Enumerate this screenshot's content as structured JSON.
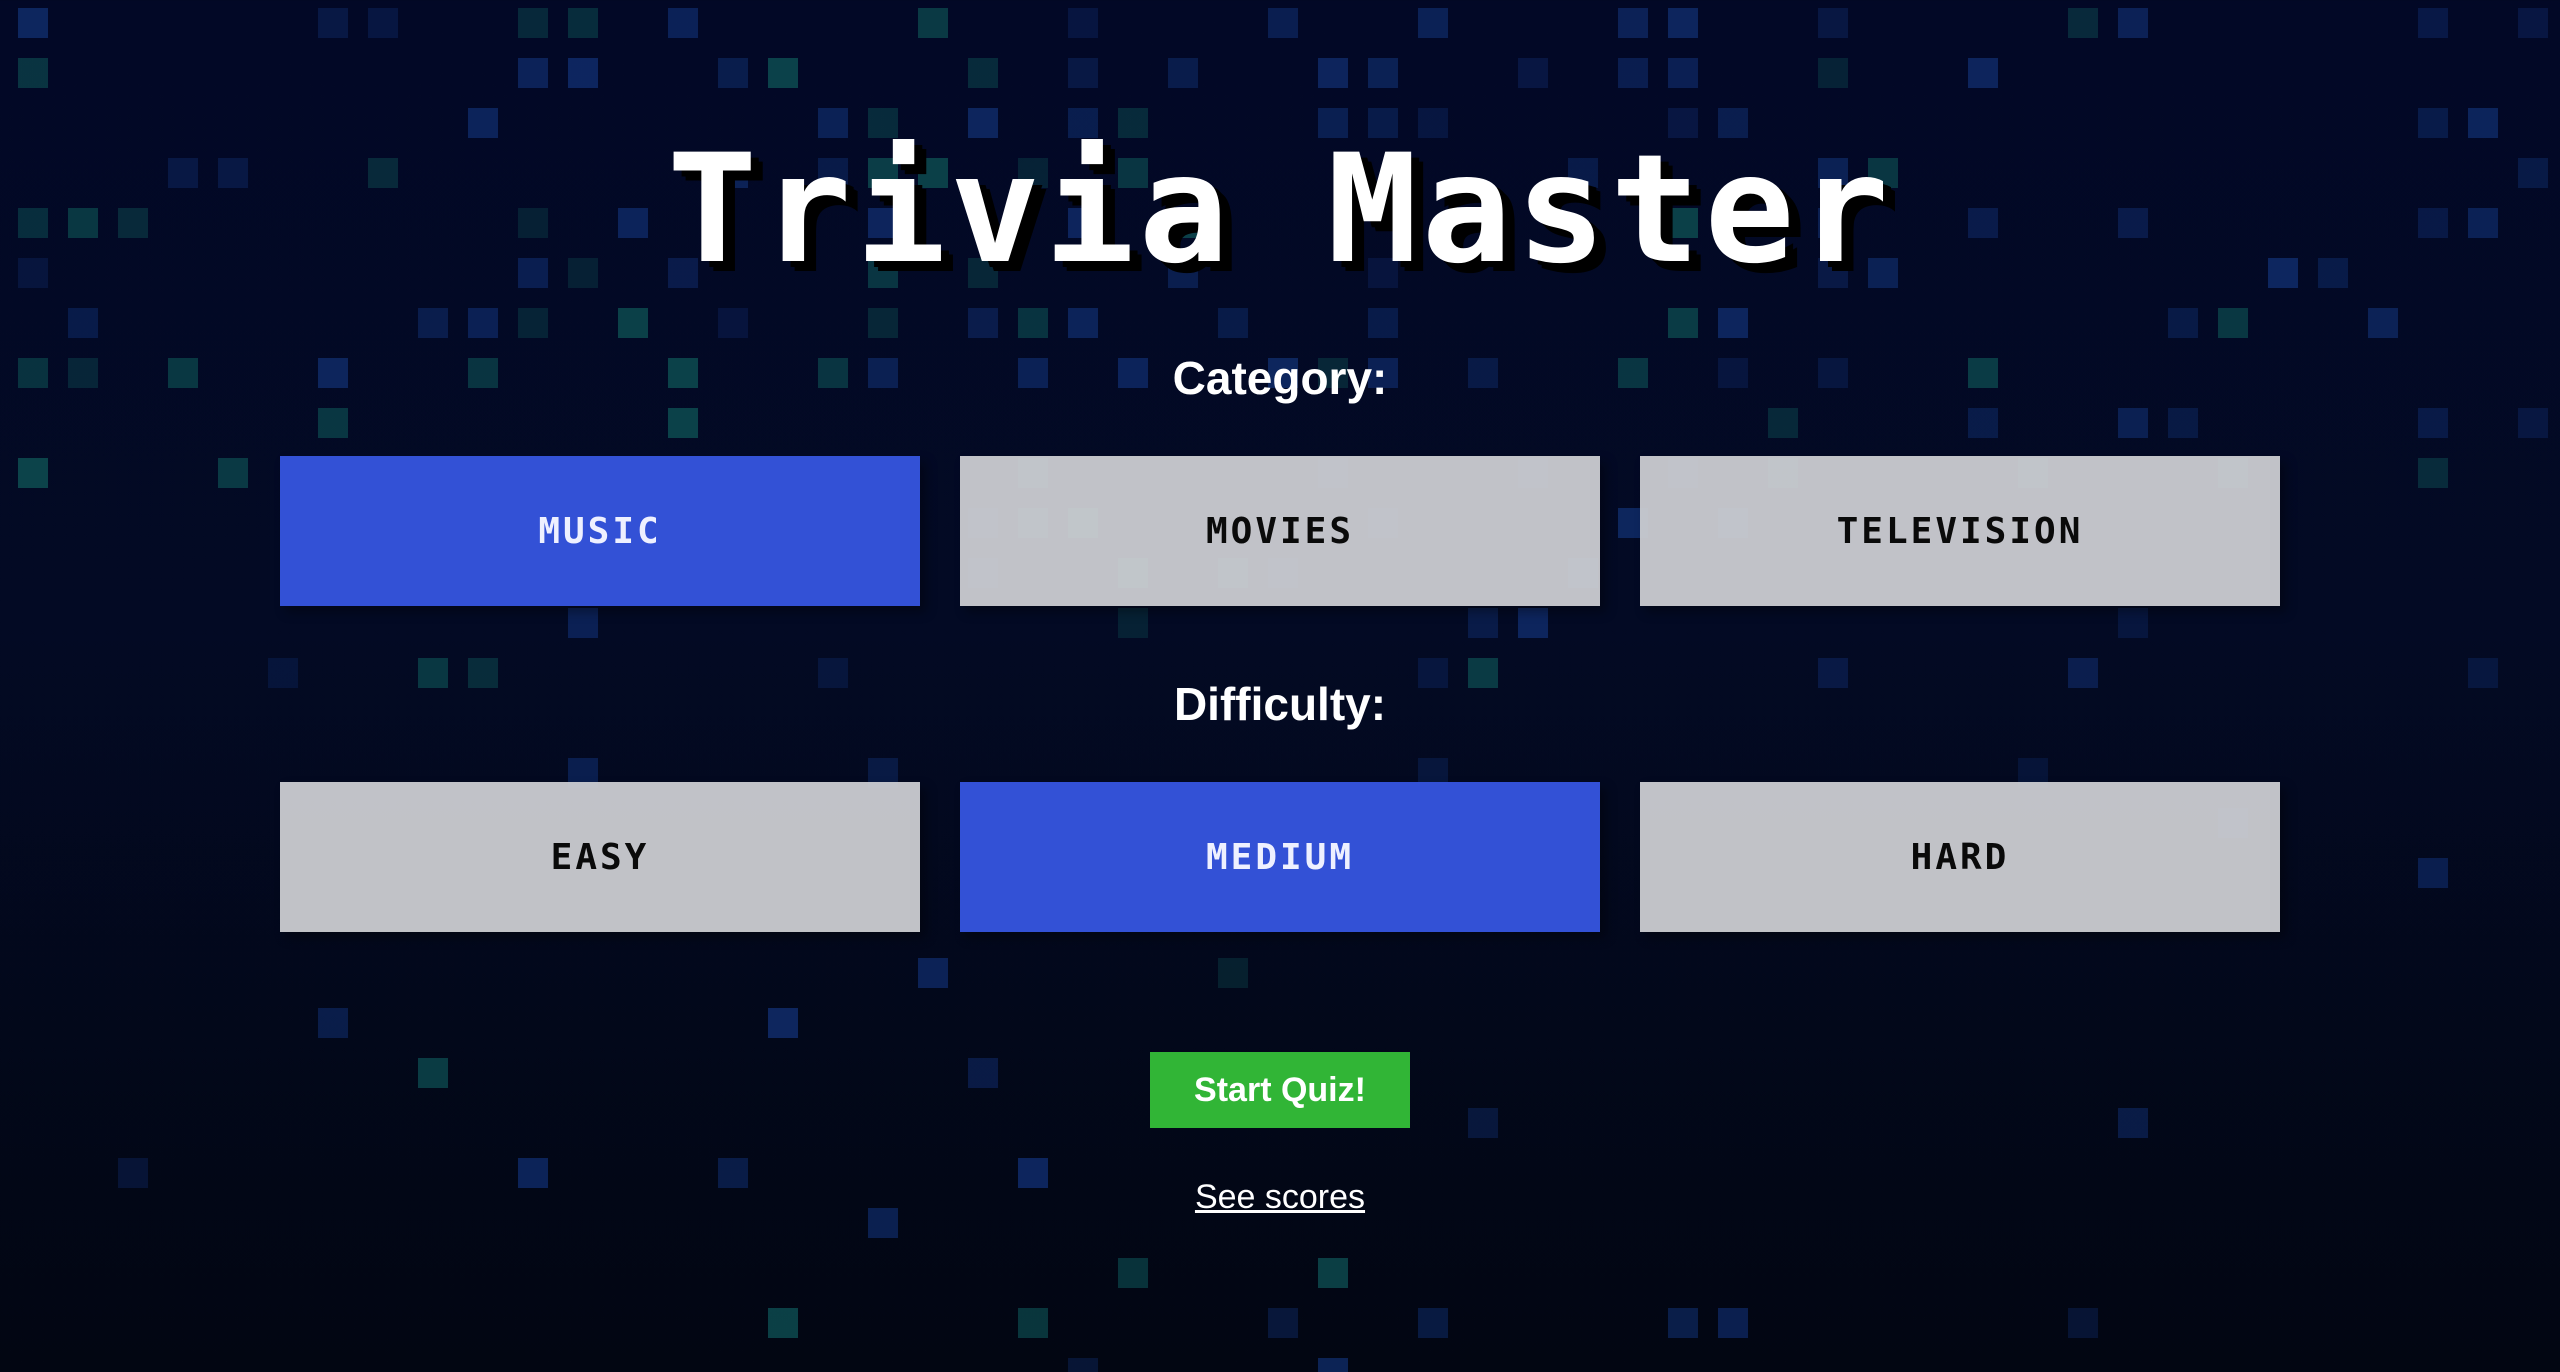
{
  "title": "Trivia Master",
  "category": {
    "label": "Category:",
    "options": [
      "MUSIC",
      "MOVIES",
      "TELEVISION"
    ],
    "selected": "MUSIC"
  },
  "difficulty": {
    "label": "Difficulty:",
    "options": [
      "EASY",
      "MEDIUM",
      "HARD"
    ],
    "selected": "MEDIUM"
  },
  "start_button": "Start Quiz!",
  "scores_link": "See scores",
  "colors": {
    "background": "#020826",
    "selected": "#3351d6",
    "unselected": "#cdced2",
    "start": "#31b536",
    "grid_blue": "#0f2a66",
    "grid_teal": "#0d4a4f"
  }
}
